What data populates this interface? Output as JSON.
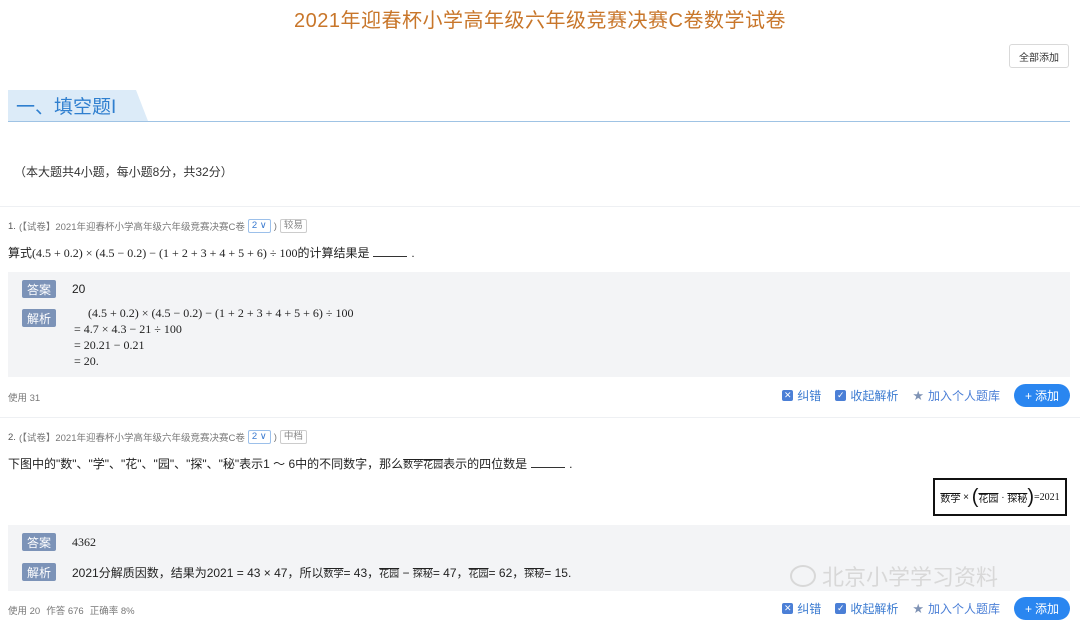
{
  "page": {
    "title": "2021年迎春杯小学高年级六年级竞赛决赛C卷数学试卷",
    "add_all": "全部添加"
  },
  "section": {
    "title": "一、填空题I",
    "desc": "（本大题共4小题，每小题8分，共32分）"
  },
  "q1": {
    "num": "1.",
    "source": "(【试卷】2021年迎春杯小学高年级六年级竞赛决赛C卷",
    "version": "2 ∨",
    "close": ")",
    "level": "较易",
    "stem_pre": "算式(4.5 + 0.2) × (4.5 − 0.2) − (1 + 2 + 3 + 4 + 5 + 6) ÷ 100的计算结果是",
    "stem_post": ".",
    "answer_tag": "答案",
    "answer": "20",
    "analysis_tag": "解析",
    "steps": [
      "(4.5 + 0.2) × (4.5 − 0.2) − (1 + 2 + 3 + 4 + 5 + 6) ÷ 100",
      "= 4.7 × 4.3 − 21 ÷ 100",
      "= 20.21 − 0.21",
      "= 20."
    ],
    "usage": "使用 31"
  },
  "q2": {
    "num": "2.",
    "source": "(【试卷】2021年迎春杯小学高年级六年级竞赛决赛C卷",
    "version": "2 ∨",
    "close": ")",
    "level": "中档",
    "stem_pre": "下图中的\"数\"、\"学\"、\"花\"、\"园\"、\"探\"、\"秘\"表示1 ～ 6中的不同数字，那么",
    "stem_word1": "数学",
    "stem_word2": "花园",
    "stem_post": "表示的四位数是",
    "stem_end": ".",
    "figure": {
      "a": "数学",
      "times": "×",
      "b": "花园",
      "dot": "·",
      "c": "探秘",
      "eq": "=2021"
    },
    "answer_tag": "答案",
    "answer": "4362",
    "analysis_tag": "解析",
    "analysis_pre": "2021分解质因数，结果为2021 = 43 × 47，所以",
    "an_w1": "数学",
    "an_t1": "= 43，",
    "an_w2": "花园",
    "an_t2": " − ",
    "an_w3": "探秘",
    "an_t3": "= 47，",
    "an_w4": "花园",
    "an_t4": "= 62，",
    "an_w5": "探秘",
    "an_t5": "= 15.",
    "usage": [
      "使用 20",
      "作答 676",
      "正确率 8%"
    ]
  },
  "actions": {
    "correct": "纠错",
    "collapse": "收起解析",
    "add_bank": "加入个人题库",
    "add": "添加"
  },
  "watermark": "北京小学学习资料",
  "colors": {
    "title": "#c8762a",
    "accent": "#2a86f0",
    "tag": "#7c93b8",
    "section": "#2f7fcf"
  }
}
